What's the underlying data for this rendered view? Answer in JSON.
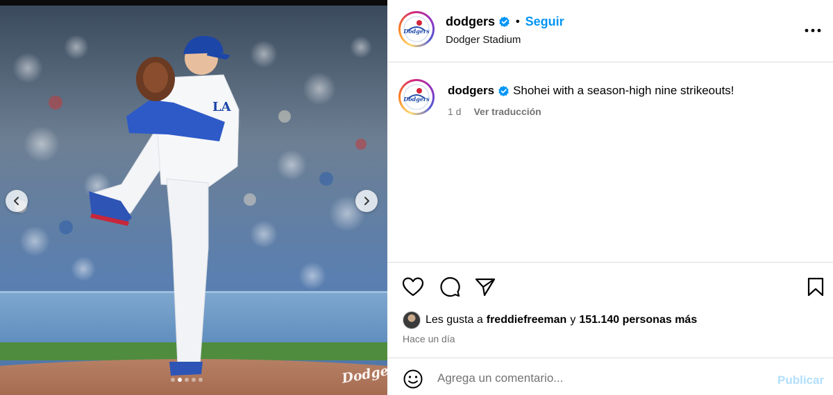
{
  "post": {
    "username": "dodgers",
    "verified_icon": "verified-badge-icon",
    "separator": "•",
    "follow_label": "Seguir",
    "location": "Dodger Stadium",
    "more_icon": "more-options-icon",
    "watermark": "Dodgers",
    "carousel": {
      "dot_count": 5,
      "active_index": 1
    }
  },
  "caption": {
    "username": "dodgers",
    "text": "Shohei with a season-high nine strikeouts!",
    "age": "1 d",
    "translate_label": "Ver traducción"
  },
  "actions": {
    "icons": [
      "heart-icon",
      "comment-icon",
      "share-icon",
      "bookmark-icon"
    ],
    "likes_prefix": "Les gusta a",
    "likes_user": "freddiefreeman",
    "likes_connector": "y",
    "likes_count_text": "151.140 personas más",
    "timestamp": "Hace un día"
  },
  "comment_box": {
    "placeholder": "Agrega un comentario...",
    "publish_label": "Publicar"
  },
  "colors": {
    "follow_blue": "#0095f6",
    "verified_blue": "#0095f6",
    "publish_disabled": "#b2dffc",
    "muted_text": "#737373"
  }
}
